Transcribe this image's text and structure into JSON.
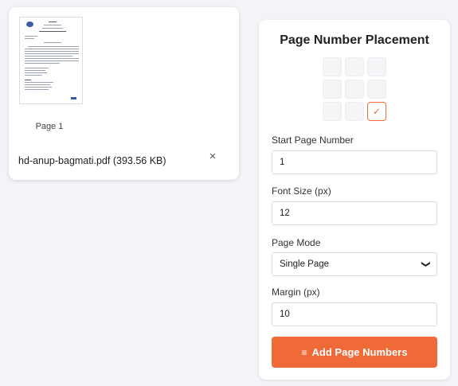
{
  "file": {
    "page_label": "Page 1",
    "name": "hd-anup-bagmati.pdf (393.56 KB)",
    "close_glyph": "×"
  },
  "panel": {
    "title": "Page Number Placement",
    "position_grid": {
      "selected_row": 3,
      "selected_col": 3,
      "check_glyph": "✓"
    },
    "start_page": {
      "label": "Start Page Number",
      "value": "1"
    },
    "font_size": {
      "label": "Font Size (px)",
      "value": "12"
    },
    "page_mode": {
      "label": "Page Mode",
      "value": "Single Page",
      "chevron": "❯"
    },
    "margin": {
      "label": "Margin (px)",
      "value": "10"
    },
    "add_button": {
      "icon": "list-ordered-icon",
      "icon_glyph": "≡",
      "label": "Add Page Numbers"
    }
  },
  "colors": {
    "accent": "#ef6a37",
    "background": "#f3f3f8"
  }
}
